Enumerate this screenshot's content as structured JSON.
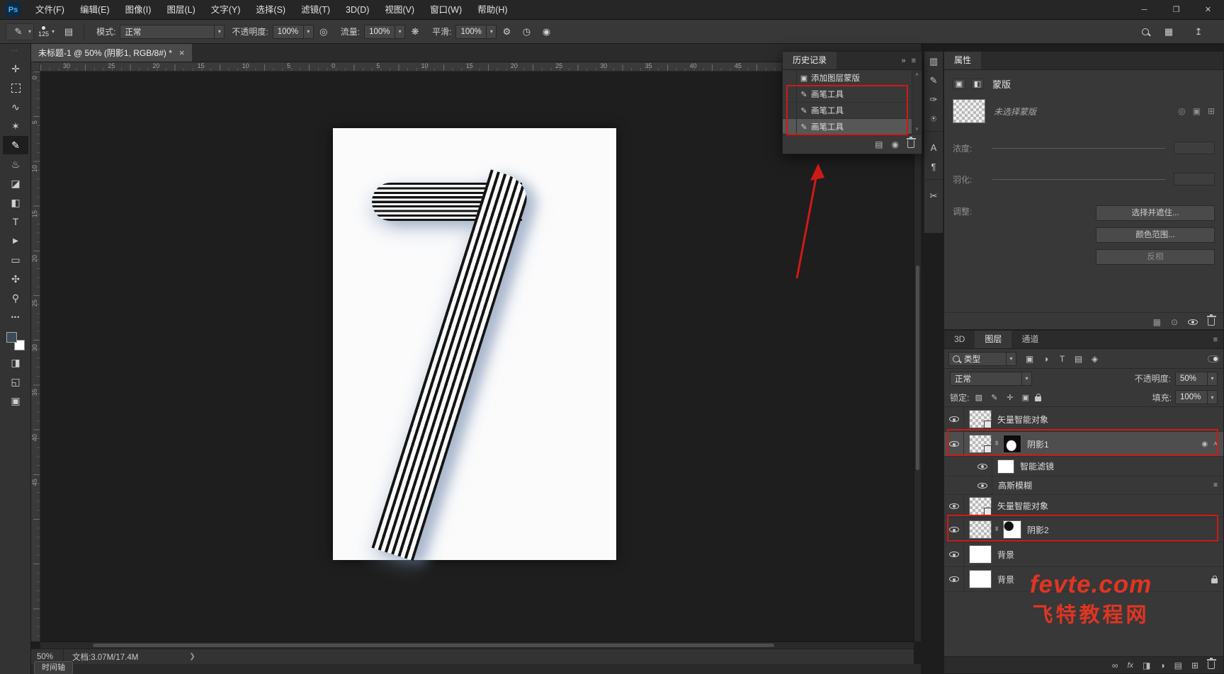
{
  "window": {
    "logo_text": "Ps",
    "controls": {
      "minimize": "─",
      "maximize": "❐",
      "close": "✕"
    }
  },
  "menubar": {
    "items": [
      "文件(F)",
      "编辑(E)",
      "图像(I)",
      "图层(L)",
      "文字(Y)",
      "选择(S)",
      "滤镜(T)",
      "3D(D)",
      "视图(V)",
      "窗口(W)",
      "帮助(H)"
    ]
  },
  "options_bar": {
    "brush_size": "125",
    "mode": {
      "label": "模式:",
      "value": "正常"
    },
    "opacity": {
      "label": "不透明度:",
      "value": "100%"
    },
    "flow": {
      "label": "流量:",
      "value": "100%"
    },
    "smoothing": {
      "label": "平滑:",
      "value": "100%"
    }
  },
  "document_tab": {
    "title": "未标题-1 @ 50% (阴影1, RGB/8#) *",
    "close_glyph": "×"
  },
  "rulers": {
    "horizontal": [
      "30",
      "25",
      "20",
      "15",
      "10",
      "5",
      "0",
      "5",
      "10",
      "15",
      "20",
      "25",
      "30",
      "35",
      "40",
      "45"
    ],
    "vertical": [
      "0",
      "5",
      "10",
      "15",
      "20",
      "25",
      "30",
      "35",
      "40",
      "45"
    ]
  },
  "history_panel": {
    "title": "历史记录",
    "items": [
      {
        "label": "添加图层蒙版"
      },
      {
        "label": "画笔工具"
      },
      {
        "label": "画笔工具"
      },
      {
        "label": "画笔工具"
      }
    ]
  },
  "properties_panel": {
    "tab": "属性",
    "section_title": "蒙版",
    "empty_text": "未选择蒙版",
    "density_label": "浓度:",
    "feather_label": "羽化:",
    "refine_label": "调整:",
    "buttons": {
      "select_and_mask": "选择并遮住...",
      "color_range": "颜色范围...",
      "invert": "反相"
    }
  },
  "layers_panel": {
    "tabs": [
      "3D",
      "图层",
      "通道"
    ],
    "filter_label": "类型",
    "blend_mode": "正常",
    "opacity_label": "不透明度:",
    "opacity_value": "50%",
    "lock_label": "锁定:",
    "fill_label": "填充:",
    "fill_value": "100%",
    "fx_glyph": "fx",
    "layers": [
      {
        "name": "矢量智能对象"
      },
      {
        "name": "阴影1"
      },
      {
        "name": "智能滤镜"
      },
      {
        "name": "高斯模糊"
      },
      {
        "name": "矢量智能对象"
      },
      {
        "name": "阴影2"
      },
      {
        "name": "背景"
      },
      {
        "name": "背景"
      }
    ]
  },
  "status_bar": {
    "zoom": "50%",
    "doc_info": "文档:3.07M/17.4M",
    "timeline_label": "时间轴"
  },
  "watermark": {
    "line1": "fevte.com",
    "line2": "飞特教程网"
  },
  "icons": {
    "grip": "⋯",
    "caret": "▾",
    "collapse": "»",
    "menu": "≡",
    "up": "˄",
    "down": "˅",
    "chevron": "❯",
    "move": "✛",
    "lasso": "∿",
    "quick_select": "✶",
    "brush": "✎",
    "clone_stamp": "♨",
    "eraser": "◪",
    "paint_bucket": "◧",
    "type": "T",
    "path_select": "▶",
    "shape": "▭",
    "hand": "✣",
    "zoom_tool": "⚲",
    "more": "•••",
    "quick_mask": "◨",
    "screen_mode": "◱",
    "edit_board": "▣",
    "panel_toggle": "▤",
    "pressure": "◎",
    "airbrush": "❋",
    "gear": "⚙",
    "angle": "◷",
    "pressure_size": "◉",
    "workspace": "▦",
    "share": "↥",
    "mask_badge": "▣",
    "vector_badge": "◧",
    "mask_link1": "◎",
    "mask_link2": "▣",
    "mask_link3": "⊞",
    "props_b1": "▦",
    "props_b2": "⊙",
    "filter_image": "▣",
    "filter_adjust": "◑",
    "filter_type": "T",
    "filter_group": "▤",
    "filter_smart": "◈",
    "lock_transparent": "▨",
    "lock_brush": "✎",
    "lock_move": "✛",
    "lock_board": "▣",
    "link": "∞",
    "smart_filter": "◉",
    "blend_opts": "≡",
    "bottom_link": "∞",
    "bottom_mask": "◨",
    "bottom_adjust": "◑",
    "bottom_group": "▤",
    "bottom_new": "⊞",
    "hist_newdoc": "▤",
    "hist_snapshot": "◉",
    "dock": [
      "▥",
      "✎",
      "✑",
      "⍟",
      "A",
      "¶",
      "✂"
    ]
  }
}
